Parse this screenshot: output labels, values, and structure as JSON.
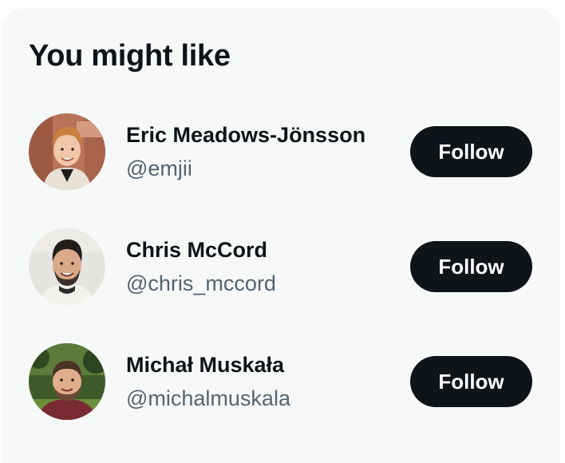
{
  "widget": {
    "title": "You might like"
  },
  "suggestions": [
    {
      "name": "Eric Meadows-Jönsson",
      "handle": "@emjii",
      "avatar_icon": "avatar-photo",
      "button_label": "Follow"
    },
    {
      "name": "Chris McCord",
      "handle": "@chris_mccord",
      "avatar_icon": "avatar-photo",
      "button_label": "Follow"
    },
    {
      "name": "Michał Muskała",
      "handle": "@michalmuskala",
      "avatar_icon": "avatar-photo",
      "button_label": "Follow"
    }
  ],
  "colors": {
    "card_background": "#f7f9f9",
    "primary_text": "#0f1419",
    "secondary_text": "#536471",
    "button_background": "#0f1419",
    "button_text": "#ffffff"
  }
}
